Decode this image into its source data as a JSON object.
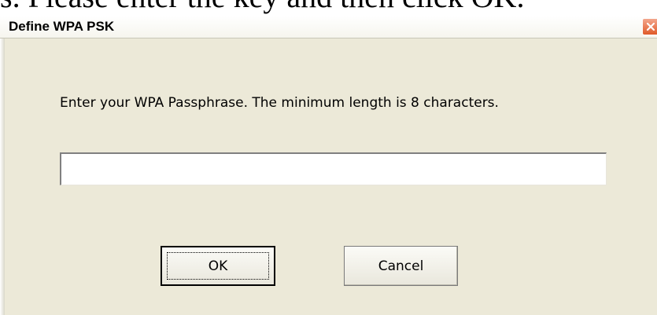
{
  "document": {
    "partial_text": "s. Please enter the key and then click OK."
  },
  "dialog": {
    "title": "Define WPA PSK",
    "prompt": "Enter your WPA Passphrase.  The minimum length is 8 characters.",
    "passphrase_value": "",
    "ok_label": "OK",
    "cancel_label": "Cancel",
    "close_icon": "close-icon",
    "colors": {
      "face": "#ece9d8",
      "close_button": "#e05a2a"
    }
  }
}
